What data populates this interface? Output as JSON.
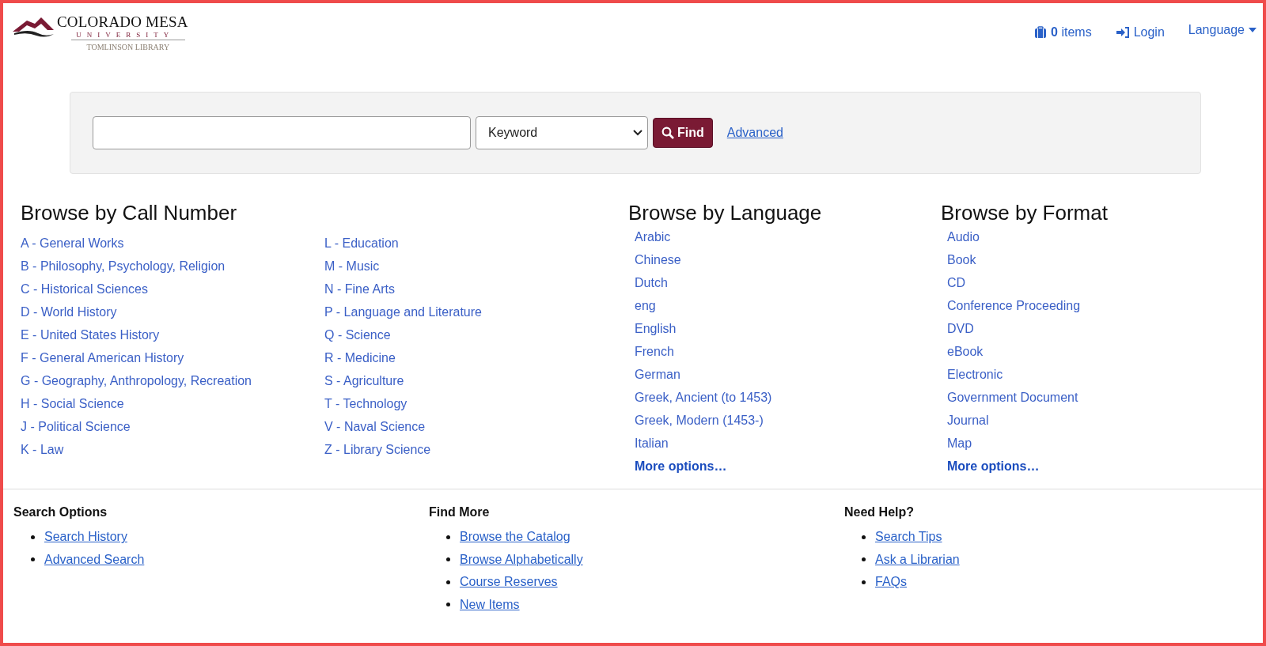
{
  "header": {
    "logo": {
      "name": "COLORADO MESA",
      "university": "UNIVERSITY",
      "library": "TOMLINSON LIBRARY"
    },
    "cart": "**0** items",
    "login": "Login",
    "language": "Language"
  },
  "search": {
    "type": "Keyword",
    "find": "Find",
    "advanced": "Advanced"
  },
  "browse_call_number": {
    "title": "Browse by Call Number",
    "columns": [
      [
        "A - General Works",
        "B - Philosophy, Psychology, Religion",
        "C - Historical Sciences",
        "D - World History",
        "E - United States History",
        "F - General American History",
        "G - Geography, Anthropology, Recreation",
        "H - Social Science",
        "J - Political Science",
        "K - Law"
      ],
      [
        "L - Education",
        "M - Music",
        "N - Fine Arts",
        "P - Language and Literature",
        "Q - Science",
        "R - Medicine",
        "S - Agriculture",
        "T - Technology",
        "V - Naval Science",
        "Z - Library Science"
      ]
    ]
  },
  "browse_language": {
    "title": "Browse by Language",
    "items": [
      "Arabic",
      "Chinese",
      "Dutch",
      "eng",
      "English",
      "French",
      "German",
      "Greek, Ancient (to 1453)",
      "Greek, Modern (1453-)",
      "Italian"
    ],
    "more": "More options…"
  },
  "browse_format": {
    "title": "Browse by Format",
    "items": [
      "Audio",
      "Book",
      "CD",
      "Conference Proceeding",
      "DVD",
      "eBook",
      "Electronic",
      "Government Document",
      "Journal",
      "Map"
    ],
    "more": "More options…"
  },
  "footer": [
    {
      "title": "Search Options",
      "links": [
        "Search History",
        "Advanced Search"
      ]
    },
    {
      "title": "Find More",
      "links": [
        "Browse the Catalog",
        "Browse Alphabetically",
        "Course Reserves",
        "New Items"
      ]
    },
    {
      "title": "Need Help?",
      "links": [
        "Search Tips",
        "Ask a Librarian",
        "FAQs"
      ]
    }
  ]
}
